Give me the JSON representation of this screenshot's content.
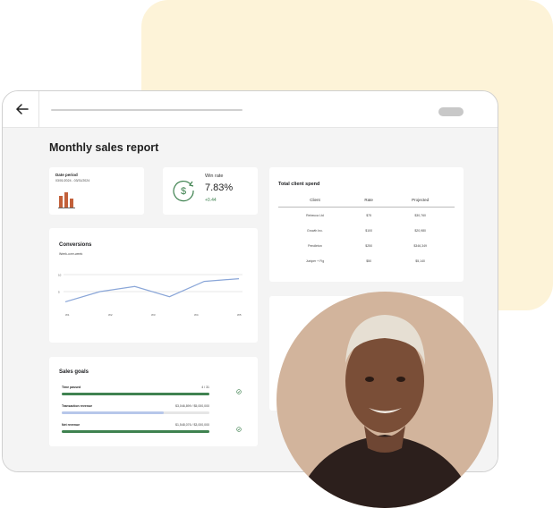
{
  "report": {
    "title": "Monthly sales report"
  },
  "date_card": {
    "label": "Date period",
    "range": "03/01/2024 - 03/31/2024"
  },
  "win_card": {
    "label": "Win rate",
    "value": "7.83%",
    "delta": "+0.44"
  },
  "conversions": {
    "title": "Conversions",
    "subtitle": "Week-over-week",
    "y_ticks": [
      "10",
      "5"
    ],
    "x_ticks": [
      "W1",
      "W2",
      "W3",
      "W4",
      "W5"
    ]
  },
  "chart_data": {
    "type": "line",
    "title": "Conversions",
    "subtitle": "Week-over-week",
    "x": [
      "W1",
      "W2",
      "W3",
      "W4",
      "W5"
    ],
    "values": [
      2,
      5,
      6.5,
      3.5,
      8,
      8.8
    ],
    "ylim": [
      0,
      10
    ],
    "grid": true
  },
  "goals": {
    "title": "Sales goals",
    "items": [
      {
        "label": "Time passed",
        "value": "4 / 31",
        "progress": 1.0,
        "color": "#3f8250",
        "check": true
      },
      {
        "label": "Transaction revenue",
        "value": "$3,046,899 / $5,000,000",
        "progress": 0.69,
        "color": "#b7c7ea",
        "check": false
      },
      {
        "label": "Net revenue",
        "value": "$1,548,076 / $3,000,000",
        "progress": 1.0,
        "color": "#3f8250",
        "check": true
      }
    ]
  },
  "spend": {
    "title": "Total client spend",
    "headers": [
      "Client",
      "Rate",
      "Projected"
    ],
    "rows": [
      [
        "Rebecca Ltd",
        "$75",
        "$30,760"
      ],
      [
        "Growth Inc.",
        "$100",
        "$20,980"
      ],
      [
        "Pendleton",
        "$250",
        "$346,349"
      ],
      [
        "Juniper + Fig",
        "$50",
        "$5,140"
      ]
    ]
  },
  "colors": {
    "accent_green": "#3f8250",
    "bars": "#c2603a",
    "line": "#8aa6d8"
  }
}
